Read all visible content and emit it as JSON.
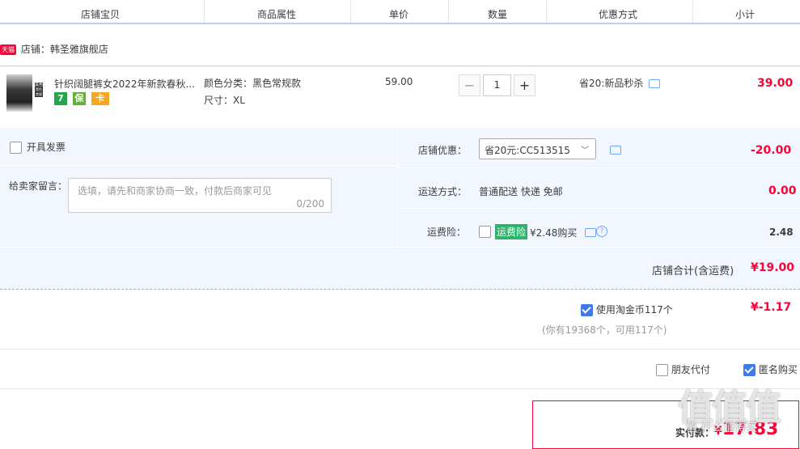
{
  "header": {
    "col_item": "店铺宝贝",
    "col_props": "商品属性",
    "col_price": "单价",
    "col_qty": "数量",
    "col_discount": "优惠方式",
    "col_subtotal": "小计"
  },
  "shop": {
    "badge": "天猫",
    "label": "店铺：韩圣雅旗舰店"
  },
  "item": {
    "title": "针织阔腿裤女2022年新款春秋...",
    "thumb_tag_top": "黑色",
    "thumb_tag_bottom": "黑色常规",
    "color_label": "颜色分类：黑色常规款",
    "size_label": "尺寸：XL",
    "price": "59.00",
    "qty_minus": "−",
    "qty": "1",
    "qty_plus": "+",
    "discount": "省20:新品秒杀",
    "subtotal": "39.00",
    "icons": [
      "7",
      "保",
      "卡"
    ]
  },
  "invoice": {
    "label": "开具发票",
    "checked": false
  },
  "message": {
    "label": "给卖家留言：",
    "placeholder": "选填，请先和商家协商一致，付款后商家可见",
    "counter": "0/200"
  },
  "shop_discount": {
    "label": "店铺优惠：",
    "selected": "省20元:CC513515",
    "value": "-20.00"
  },
  "shipping": {
    "label": "运送方式：",
    "value_text": "普通配送 快递 免邮",
    "value": "0.00"
  },
  "insurance": {
    "label": "运费险：",
    "badge": "运费险",
    "text": "¥2.48购买",
    "value": "2.48",
    "help": "?"
  },
  "shop_total": {
    "label": "店铺合计(含运费)",
    "value": "¥19.00"
  },
  "coins": {
    "label": "使用淘金币117个",
    "value": "¥-1.17",
    "note": "(你有19368个，可用117个)",
    "checked": true
  },
  "options": {
    "friend_pay": "朋友代付",
    "anonymous": "匿名购买",
    "anonymous_checked": true
  },
  "final": {
    "label": "实付款：",
    "currency": "¥",
    "value": "17.83",
    "watermark": "值 什么值得买"
  },
  "colors": {
    "accent_red": "#ff0036",
    "panel_bg": "#f2f7ff",
    "header_line": "#b2d1ff",
    "check_blue": "#3f7be8",
    "insurance_green": "#2fb26b"
  }
}
